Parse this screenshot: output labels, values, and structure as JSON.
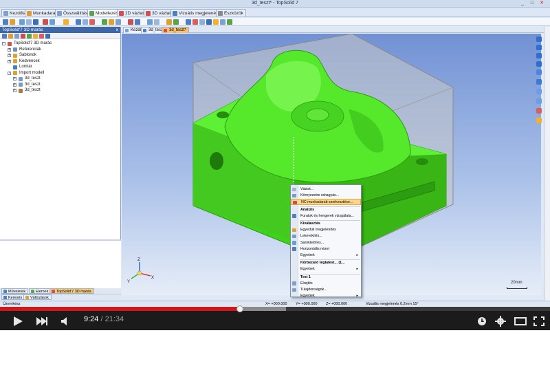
{
  "window": {
    "title": "3d_teszt* - TopSolid 7",
    "min": "_",
    "max": "□",
    "close": "✕"
  },
  "ribbon_tabs": [
    "Kezdőlap",
    "Munkadarab",
    "Összeállítás",
    "Modellezés",
    "2D vázlat",
    "3D vázlat",
    "Vizuális megjelenés",
    "Eszközök"
  ],
  "left_panel": {
    "title": "TopSolid'7 3D marás",
    "close": "x",
    "tree": [
      {
        "label": "TopSolid'7 3D marás",
        "indent": 0,
        "expander": "-",
        "color": "#d9534f"
      },
      {
        "label": "Referenciák",
        "indent": 1,
        "expander": "+",
        "color": "#6b8ec9"
      },
      {
        "label": "Sablonok",
        "indent": 1,
        "expander": "+",
        "color": "#e0a030"
      },
      {
        "label": "Kedvencek",
        "indent": 1,
        "expander": "+",
        "color": "#e0a030"
      },
      {
        "label": "Lomtár",
        "indent": 1,
        "expander": "",
        "color": "#3c7fc7"
      },
      {
        "label": "Import modell",
        "indent": 1,
        "expander": "-",
        "color": "#e0a030"
      },
      {
        "label": "3d_teszt",
        "indent": 2,
        "expander": "+",
        "color": "#7a9bc8"
      },
      {
        "label": "3d_teszt",
        "indent": 2,
        "expander": "+",
        "color": "#7a9bc8"
      },
      {
        "label": "3d_teszt",
        "indent": 2,
        "expander": "+",
        "color": "#b07a3a"
      }
    ],
    "bottom_tabs": [
      "Műveletek",
      "Elemek",
      "TopSolid'7 3D marás"
    ],
    "bottom_tabs2": [
      "Keresés",
      "Változások"
    ]
  },
  "doc_tabs": [
    "Kezdőlap",
    "3d_teszt",
    "3d_teszt*"
  ],
  "context_menu": [
    {
      "label": "Vázlat...",
      "type": "item",
      "arrow": ""
    },
    {
      "label": "Környezetre rahagyás...",
      "type": "item",
      "arrow": ""
    },
    {
      "label": "NC munkadarab szerkesztése...",
      "type": "highlight",
      "arrow": ""
    },
    {
      "label": "Analízis",
      "type": "header",
      "arrow": ""
    },
    {
      "label": "Furatok és hengerek vizsgálata...",
      "type": "item",
      "arrow": ""
    },
    {
      "label": "Kiválasztás",
      "type": "header",
      "arrow": ""
    },
    {
      "label": "Egyedüli megjelenítés",
      "type": "item",
      "arrow": ""
    },
    {
      "label": "Lekerekítés...",
      "type": "item",
      "arrow": ""
    },
    {
      "label": "Sarokletörés...",
      "type": "item",
      "arrow": ""
    },
    {
      "label": "Horizontális nézet",
      "type": "item",
      "arrow": ""
    },
    {
      "label": "Egyebek",
      "type": "item",
      "arrow": "▸"
    },
    {
      "label": "Körbezáró téglatest... (1...",
      "type": "header",
      "arrow": ""
    },
    {
      "label": "Egyebek",
      "type": "item",
      "arrow": "▸"
    },
    {
      "label": "Test 1",
      "type": "header",
      "arrow": ""
    },
    {
      "label": "Elrejtés",
      "type": "item",
      "arrow": ""
    },
    {
      "label": "Tulajdonságok...",
      "type": "item",
      "arrow": ""
    },
    {
      "label": "Egyebek",
      "type": "item",
      "arrow": "▸"
    }
  ],
  "status": {
    "left": "Üzemkész",
    "x": "X= +000.000",
    "y": "Y= +000.000",
    "z": "Z= +000.000",
    "visual": "Vizuális megjelenés 0,2mm 15°"
  },
  "scale": "20mm",
  "axis_labels": {
    "x": "X",
    "y": "Y",
    "z": "Z"
  },
  "player": {
    "current": "9:24",
    "separator": " / ",
    "duration": "21:34",
    "played_fraction": 0.436,
    "buffered_fraction": 0.52
  },
  "colors": {
    "part_green": "#46e01c",
    "stock_box": "#c7c7c7",
    "highlight": "#fbd58d",
    "progress_red": "#cc181e"
  }
}
